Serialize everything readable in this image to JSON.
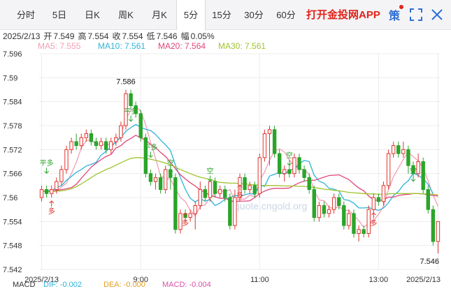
{
  "tabs": [
    {
      "label": "分时",
      "active": false
    },
    {
      "label": "5日",
      "active": false
    },
    {
      "label": "日K",
      "active": false
    },
    {
      "label": "周K",
      "active": false
    },
    {
      "label": "月K",
      "active": false
    },
    {
      "label": "5分",
      "active": true
    },
    {
      "label": "15分",
      "active": false
    },
    {
      "label": "30分",
      "active": false
    },
    {
      "label": "60分",
      "active": false
    }
  ],
  "promo_text": "打开金投网APP",
  "toolbar": {
    "strategy_label": "策",
    "accent": "#e2231a",
    "icons": [
      "strategy-icon",
      "fullscreen-icon",
      "close-icon"
    ]
  },
  "info": {
    "date": "2025/2/13",
    "open_label": "开",
    "open": "7.549",
    "high_label": "高",
    "high": "7.554",
    "close_label": "收",
    "close": "7.554",
    "low_label": "低",
    "low": "7.546",
    "amp_label": "幅",
    "amp": "0.05%"
  },
  "ma": [
    {
      "label": "MA5: 7.555",
      "color": "#f29fb4"
    },
    {
      "label": "MA10: 7.561",
      "color": "#2eb4d9"
    },
    {
      "label": "MA20: 7.564",
      "color": "#e0457b"
    },
    {
      "label": "MA30: 7.561",
      "color": "#9fc32d"
    }
  ],
  "watermark": "quote.cngold.org",
  "chart_data": {
    "type": "candlestick",
    "ylim": [
      7.542,
      7.596
    ],
    "y_ticks": [
      "7.596",
      "7.59",
      "7.584",
      "7.578",
      "7.572",
      "7.566",
      "7.56",
      "7.554",
      "7.548",
      "7.542"
    ],
    "x_ticks": [
      {
        "label": "2025/2/13",
        "index": 0
      },
      {
        "label": "9:00",
        "index": 20
      },
      {
        "label": "11:00",
        "index": 44
      },
      {
        "label": "13:00",
        "index": 68
      },
      {
        "label": "2025/2/13",
        "index": 80
      }
    ],
    "up_color": "#e0342f",
    "down_color": "#2aa52a",
    "candles": [
      [
        7.56,
        7.562,
        7.563,
        7.559
      ],
      [
        7.562,
        7.561,
        7.563,
        7.56
      ],
      [
        7.561,
        7.562,
        7.563,
        7.56
      ],
      [
        7.562,
        7.564,
        7.565,
        7.561
      ],
      [
        7.564,
        7.567,
        7.568,
        7.563
      ],
      [
        7.567,
        7.572,
        7.573,
        7.566
      ],
      [
        7.572,
        7.574,
        7.575,
        7.571
      ],
      [
        7.574,
        7.573,
        7.576,
        7.572
      ],
      [
        7.573,
        7.575,
        7.576,
        7.572
      ],
      [
        7.575,
        7.576,
        7.577,
        7.574
      ],
      [
        7.576,
        7.574,
        7.577,
        7.573
      ],
      [
        7.574,
        7.573,
        7.575,
        7.572
      ],
      [
        7.573,
        7.574,
        7.575,
        7.572
      ],
      [
        7.574,
        7.572,
        7.575,
        7.571
      ],
      [
        7.572,
        7.574,
        7.575,
        7.571
      ],
      [
        7.574,
        7.575,
        7.576,
        7.573
      ],
      [
        7.575,
        7.578,
        7.579,
        7.574
      ],
      [
        7.578,
        7.586,
        7.587,
        7.577
      ],
      [
        7.586,
        7.583,
        7.587,
        7.582
      ],
      [
        7.583,
        7.581,
        7.584,
        7.58
      ],
      [
        7.581,
        7.575,
        7.582,
        7.574
      ],
      [
        7.575,
        7.566,
        7.576,
        7.565
      ],
      [
        7.566,
        7.564,
        7.567,
        7.563
      ],
      [
        7.564,
        7.565,
        7.566,
        7.562
      ],
      [
        7.565,
        7.562,
        7.566,
        7.561
      ],
      [
        7.562,
        7.567,
        7.568,
        7.561
      ],
      [
        7.567,
        7.565,
        7.568,
        7.562
      ],
      [
        7.565,
        7.552,
        7.566,
        7.551
      ],
      [
        7.552,
        7.556,
        7.557,
        7.551
      ],
      [
        7.556,
        7.555,
        7.557,
        7.554
      ],
      [
        7.555,
        7.556,
        7.557,
        7.554
      ],
      [
        7.556,
        7.558,
        7.559,
        7.552
      ],
      [
        7.558,
        7.562,
        7.564,
        7.557
      ],
      [
        7.562,
        7.56,
        7.563,
        7.559
      ],
      [
        7.56,
        7.564,
        7.565,
        7.559
      ],
      [
        7.564,
        7.561,
        7.565,
        7.56
      ],
      [
        7.561,
        7.562,
        7.563,
        7.56
      ],
      [
        7.562,
        7.56,
        7.563,
        7.559
      ],
      [
        7.56,
        7.553,
        7.561,
        7.552
      ],
      [
        7.553,
        7.56,
        7.562,
        7.552
      ],
      [
        7.56,
        7.565,
        7.566,
        7.559
      ],
      [
        7.565,
        7.562,
        7.566,
        7.561
      ],
      [
        7.562,
        7.563,
        7.564,
        7.561
      ],
      [
        7.563,
        7.561,
        7.564,
        7.56
      ],
      [
        7.561,
        7.57,
        7.571,
        7.56
      ],
      [
        7.57,
        7.576,
        7.577,
        7.569
      ],
      [
        7.576,
        7.577,
        7.578,
        7.568
      ],
      [
        7.577,
        7.571,
        7.578,
        7.57
      ],
      [
        7.571,
        7.566,
        7.572,
        7.565
      ],
      [
        7.566,
        7.567,
        7.568,
        7.564
      ],
      [
        7.567,
        7.566,
        7.568,
        7.565
      ],
      [
        7.566,
        7.57,
        7.571,
        7.565
      ],
      [
        7.57,
        7.567,
        7.571,
        7.566
      ],
      [
        7.567,
        7.565,
        7.568,
        7.564
      ],
      [
        7.565,
        7.562,
        7.566,
        7.561
      ],
      [
        7.562,
        7.555,
        7.563,
        7.554
      ],
      [
        7.555,
        7.558,
        7.559,
        7.554
      ],
      [
        7.558,
        7.556,
        7.559,
        7.555
      ],
      [
        7.556,
        7.557,
        7.558,
        7.555
      ],
      [
        7.557,
        7.56,
        7.561,
        7.556
      ],
      [
        7.56,
        7.558,
        7.561,
        7.557
      ],
      [
        7.558,
        7.553,
        7.559,
        7.552
      ],
      [
        7.553,
        7.556,
        7.557,
        7.552
      ],
      [
        7.556,
        7.551,
        7.557,
        7.55
      ],
      [
        7.551,
        7.552,
        7.553,
        7.549
      ],
      [
        7.552,
        7.551,
        7.553,
        7.55
      ],
      [
        7.551,
        7.557,
        7.558,
        7.55
      ],
      [
        7.557,
        7.56,
        7.561,
        7.556
      ],
      [
        7.56,
        7.559,
        7.561,
        7.558
      ],
      [
        7.559,
        7.563,
        7.564,
        7.558
      ],
      [
        7.563,
        7.571,
        7.572,
        7.562
      ],
      [
        7.571,
        7.573,
        7.574,
        7.57
      ],
      [
        7.573,
        7.571,
        7.574,
        7.57
      ],
      [
        7.571,
        7.572,
        7.574,
        7.57
      ],
      [
        7.572,
        7.568,
        7.573,
        7.566
      ],
      [
        7.568,
        7.566,
        7.569,
        7.565
      ],
      [
        7.566,
        7.569,
        7.571,
        7.565
      ],
      [
        7.569,
        7.562,
        7.57,
        7.561
      ],
      [
        7.562,
        7.557,
        7.563,
        7.556
      ],
      [
        7.557,
        7.549,
        7.558,
        7.548
      ],
      [
        7.549,
        7.554,
        7.554,
        7.546
      ]
    ],
    "ma_lines": {
      "MA5": [
        7.5615,
        7.5615,
        7.5615,
        7.5617,
        7.5626,
        7.5636,
        7.566,
        7.5688,
        7.5724,
        7.5742,
        7.5744,
        7.5734,
        7.5734,
        7.5732,
        7.5734,
        7.5736,
        7.5756,
        7.5798,
        7.5818,
        7.5828,
        7.5816,
        7.5782,
        7.5738,
        7.5698,
        7.5654,
        7.5648,
        7.5646,
        7.5622,
        7.56,
        7.559,
        7.5568,
        7.5554,
        7.5578,
        7.5582,
        7.56,
        7.561,
        7.5618,
        7.5614,
        7.562,
        7.5592,
        7.5596,
        7.5596,
        7.5606,
        7.5602,
        7.5642,
        7.5664,
        7.5694,
        7.5716,
        7.5722,
        7.5714,
        7.5694,
        7.568,
        7.5672,
        7.567,
        7.5658,
        7.5618,
        7.5594,
        7.5592,
        7.5576,
        7.5572,
        7.5578,
        7.5568,
        7.5568,
        7.5556,
        7.5542,
        7.5526,
        7.5534,
        7.5542,
        7.5558,
        7.5578,
        7.562,
        7.5652,
        7.5674,
        7.5696,
        7.5714,
        7.5702,
        7.5692,
        7.5674,
        7.5642,
        7.5606,
        7.5578
      ],
      "MA10": [
        7.5615,
        7.5617,
        7.5617,
        7.5625,
        7.563,
        7.5643,
        7.5653,
        7.5663,
        7.567,
        7.5679,
        7.5683,
        7.5688,
        7.5706,
        7.5716,
        7.5726,
        7.574,
        7.575,
        7.5766,
        7.5775,
        7.5783,
        7.5776,
        7.5771,
        7.5768,
        7.5758,
        7.5744,
        7.5732,
        7.5718,
        7.5681,
        7.565,
        7.5621,
        7.5598,
        7.5589,
        7.5597,
        7.5591,
        7.5595,
        7.558,
        7.5586,
        7.5596,
        7.56,
        7.5605,
        7.5603,
        7.5607,
        7.561,
        7.5608,
        7.5631,
        7.5628,
        7.5654,
        7.5658,
        7.5664,
        7.5658,
        7.5668,
        7.5672,
        7.5685,
        7.5693,
        7.569,
        7.5656,
        7.5641,
        7.5636,
        7.5623,
        7.5621,
        7.5616,
        7.5595,
        7.5593,
        7.5586,
        7.5574,
        7.5574,
        7.5575,
        7.5571,
        7.5568,
        7.5574,
        7.5587,
        7.5605,
        7.5615,
        7.5632,
        7.5642,
        7.5661,
        7.5656,
        7.5647,
        7.5633,
        7.561
      ],
      "MA20": [
        7.5615,
        7.5616,
        7.5616,
        7.5618,
        7.562,
        7.5622,
        7.5625,
        7.5633,
        7.5648,
        7.5662,
        7.5676,
        7.5686,
        7.5695,
        7.5703,
        7.5708,
        7.5724,
        7.573,
        7.5741,
        7.5748,
        7.5756,
        7.5749,
        7.5744,
        7.5733,
        7.5725,
        7.5713,
        7.5703,
        7.5688,
        7.5672,
        7.5657,
        7.5647,
        7.5637,
        7.5629,
        7.5619,
        7.5613,
        7.5605,
        7.5602,
        7.5598,
        7.5598,
        7.5593,
        7.5589,
        7.5591,
        7.5591,
        7.5592,
        7.56,
        7.561,
        7.5616,
        7.5621,
        7.5623,
        7.5623,
        7.5623,
        7.5624,
        7.5631,
        7.5637,
        7.5641,
        7.5644,
        7.5643,
        7.5647,
        7.5651,
        7.5655,
        7.5656,
        7.5657,
        7.5651,
        7.5645,
        7.5634,
        7.5624,
        7.5617,
        7.5604,
        7.5595,
        7.5592,
        7.5595,
        7.5601,
        7.5601,
        7.5605,
        7.5607,
        7.5608,
        7.561,
        7.561,
        7.5609,
        7.5607,
        7.5605,
        7.5604
      ],
      "MA30": [
        7.5615,
        7.5615,
        7.5615,
        7.5616,
        7.5617,
        7.5619,
        7.5622,
        7.5627,
        7.5634,
        7.5642,
        7.565,
        7.5658,
        7.5664,
        7.567,
        7.5675,
        7.5681,
        7.5687,
        7.5693,
        7.5698,
        7.57,
        7.57,
        7.5698,
        7.5696,
        7.5693,
        7.569,
        7.5686,
        7.5682,
        7.5676,
        7.567,
        7.5665,
        7.566,
        7.5655,
        7.5651,
        7.5648,
        7.5645,
        7.5641,
        7.5638,
        7.5637,
        7.5636,
        7.5636,
        7.5635,
        7.5634,
        7.5633,
        7.5632,
        7.5631,
        7.563,
        7.563,
        7.563,
        7.563,
        7.5629,
        7.5629,
        7.5629,
        7.5628,
        7.5628,
        7.5627,
        7.5625,
        7.5623,
        7.5621,
        7.562,
        7.5618,
        7.5617,
        7.5615,
        7.5613,
        7.5612,
        7.5611,
        7.561,
        7.5609,
        7.5609,
        7.5608,
        7.5608,
        7.5609,
        7.561,
        7.561,
        7.561,
        7.561,
        7.561,
        7.561,
        7.5609,
        7.5609,
        7.5608,
        7.5607
      ]
    },
    "peak_label": {
      "text": "7.586",
      "index": 17
    },
    "last_label": {
      "text": "7.546",
      "index": 80
    },
    "signals": [
      {
        "text": "平多",
        "index": 1,
        "y": 7.568,
        "arrow": "down",
        "color": "#2aa52a"
      },
      {
        "text": "多",
        "index": 2,
        "y": 7.556,
        "arrow": "up",
        "color": "#e0342f"
      },
      {
        "text": "平多",
        "index": 18,
        "y": 7.581,
        "arrow": "down",
        "color": "#2aa52a"
      },
      {
        "text": "平多",
        "index": 22,
        "y": 7.572,
        "arrow": "down",
        "color": "#2aa52a"
      },
      {
        "text": "空",
        "index": 26,
        "y": 7.568,
        "arrow": "down",
        "color": "#2aa52a"
      },
      {
        "text": "多",
        "index": 29,
        "y": 7.553,
        "arrow": "up",
        "color": "#e0342f"
      },
      {
        "text": "空",
        "index": 34,
        "y": 7.566,
        "arrow": "down",
        "color": "#2aa52a"
      },
      {
        "text": "多",
        "index": 40,
        "y": 7.56,
        "arrow": "up",
        "color": "#e0342f"
      },
      {
        "text": "空",
        "index": 50,
        "y": 7.57,
        "arrow": "down",
        "color": "#2aa52a"
      },
      {
        "text": "多",
        "index": 67,
        "y": 7.553,
        "arrow": "up",
        "color": "#e0342f"
      },
      {
        "text": "空",
        "index": 75,
        "y": 7.566,
        "arrow": "down",
        "color": "#2aa52a"
      }
    ]
  },
  "bottom": [
    {
      "label": "MACD",
      "color": "#333333"
    },
    {
      "label": "DIF: -0.002",
      "color": "#2eb4d9"
    },
    {
      "label": "DEA: -0.000",
      "color": "#e0a020"
    },
    {
      "label": "MACD: -0.004",
      "color": "#d94fa8"
    }
  ]
}
